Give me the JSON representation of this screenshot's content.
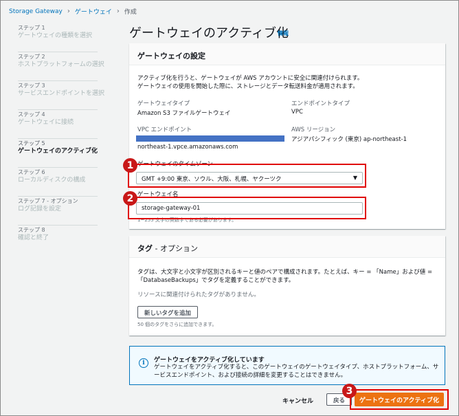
{
  "breadcrumb": {
    "home": "Storage Gateway",
    "parent": "ゲートウェイ",
    "current": "作成"
  },
  "steps": [
    {
      "num": "ステップ 1",
      "label": "ゲートウェイの種類を選択"
    },
    {
      "num": "ステップ 2",
      "label": "ホストプラットフォームの選択"
    },
    {
      "num": "ステップ 3",
      "label": "サービスエンドポイントを選択"
    },
    {
      "num": "ステップ 4",
      "label": "ゲートウェイに接続"
    },
    {
      "num": "ステップ 5",
      "label": "ゲートウェイのアクティブ化"
    },
    {
      "num": "ステップ 6",
      "label": "ローカルディスクの構成"
    },
    {
      "num": "ステップ 7 - オプション",
      "label": "ログ記録を設定"
    },
    {
      "num": "ステップ 8",
      "label": "確認と終了"
    }
  ],
  "page": {
    "title": "ゲートウェイのアクティブ化",
    "info": "情報"
  },
  "settings": {
    "heading": "ゲートウェイの設定",
    "desc1": "アクティブ化を行うと、ゲートウェイが AWS アカウントに安全に関連付けられます。",
    "desc2": "ゲートウェイの使用を開始した際に、ストレージとデータ転送料金が適用されます。",
    "type_label": "ゲートウェイタイプ",
    "type_value": "Amazon S3 ファイルゲートウェイ",
    "endpoint_type_label": "エンドポイントタイプ",
    "endpoint_type_value": "VPC",
    "vpc_label": "VPC エンドポイント",
    "vpc_value": "northeast-1.vpce.amazonaws.com",
    "region_label": "AWS リージョン",
    "region_value": "アジアパシフィック (東京) ap-northeast-1",
    "timezone_label": "ゲートウェイのタイムゾーン",
    "timezone_value": "GMT +9:00 東京、ソウル、大阪、札幌、ヤクーツク",
    "name_label": "ゲートウェイ名",
    "name_value": "storage-gateway-01",
    "name_hint": "1~255 文字の英数字である必要があります。"
  },
  "tags": {
    "heading": "タグ",
    "heading_opt": " - オプション",
    "desc1": "タグは、大文字と小文字が区別されるキーと値のペアで構成されます。たとえば、キー = 「Name」および値 =",
    "desc2": "「DatabaseBackups」でタグを定義することができます。",
    "empty": "リソースに関連付けられたタグがありません。",
    "add_button": "新しいタグを追加",
    "limit": "50 個のタグをさらに追加できます。"
  },
  "alert": {
    "title": "ゲートウェイをアクティブ化しています",
    "body": "ゲートウェイをアクティブ化すると、このゲートウェイのゲートウェイタイプ、ホストプラットフォーム、サービスエンドポイント、および接続の詳細を変更することはできません。"
  },
  "footer": {
    "cancel": "キャンセル",
    "back": "戻る",
    "activate": "ゲートウェイのアクティブ化"
  },
  "markers": [
    "1",
    "2",
    "3"
  ],
  "colors": {
    "link": "#0073bb",
    "primary": "#ec7211",
    "callout": "#e00000",
    "redaction": "#4472c4"
  }
}
